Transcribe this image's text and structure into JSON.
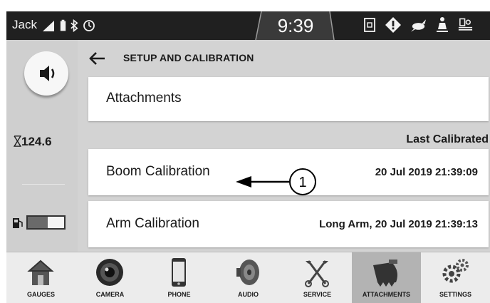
{
  "status_bar": {
    "user": "Jack",
    "time": "9:39",
    "left_icons": [
      "signal-icon",
      "battery-icon",
      "bluetooth-icon",
      "clock-icon"
    ],
    "right_icons": [
      "hydraulic-lock-icon",
      "warning-icon",
      "rabbit-speed-icon",
      "seat-operator-icon",
      "lift-mode-icon"
    ]
  },
  "left_panel": {
    "volume_icon": "speaker-icon",
    "hours": "124.6",
    "hours_icon": "hourglass-icon",
    "fuel_icon": "fuel-pump-icon",
    "fuel_level": 0.55
  },
  "header": {
    "title": "SETUP AND CALIBRATION"
  },
  "list": {
    "attachments_label": "Attachments",
    "last_calibrated_label": "Last Calibrated",
    "boom_label": "Boom Calibration",
    "boom_value": "20 Jul 2019 21:39:09",
    "arm_label": "Arm Calibration",
    "arm_value": "Long Arm, 20 Jul 2019 21:39:13"
  },
  "callout": {
    "number": "1"
  },
  "nav": {
    "items": [
      {
        "label": "GAUGES",
        "icon": "house-icon"
      },
      {
        "label": "CAMERA",
        "icon": "camera-lens-icon"
      },
      {
        "label": "PHONE",
        "icon": "phone-icon"
      },
      {
        "label": "AUDIO",
        "icon": "speaker-cone-icon"
      },
      {
        "label": "SERVICE",
        "icon": "wrenches-icon"
      },
      {
        "label": "ATTACHMENTS",
        "icon": "bucket-icon"
      },
      {
        "label": "SETTINGS",
        "icon": "gears-icon"
      }
    ],
    "active": "ATTACHMENTS"
  }
}
